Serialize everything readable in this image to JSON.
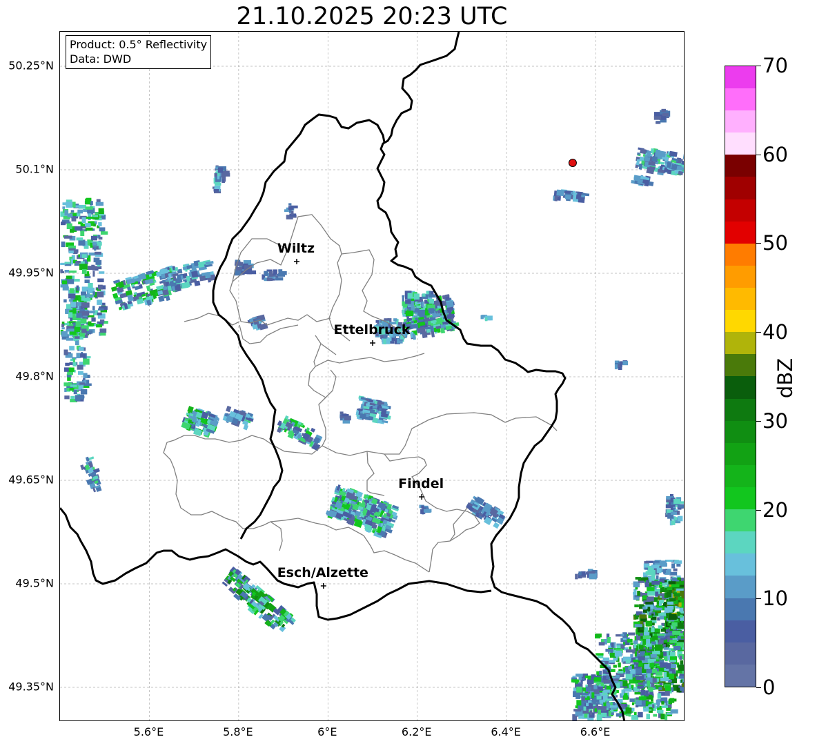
{
  "title": "21.10.2025 20:23 UTC",
  "info": {
    "product": "Product: 0.5° Reflectivity",
    "source": "Data: DWD"
  },
  "map": {
    "lon_range": [
      5.4,
      6.8
    ],
    "lat_range": [
      49.3,
      50.3
    ],
    "lat_ticks": [
      "50.25°N",
      "50.1°N",
      "49.95°N",
      "49.8°N",
      "49.65°N",
      "49.5°N",
      "49.35°N"
    ],
    "lon_ticks": [
      "5.6°E",
      "5.8°E",
      "6°E",
      "6.2°E",
      "6.4°E",
      "6.6°E"
    ],
    "grid": true,
    "cities": [
      {
        "name": "Wiltz",
        "lon": 5.93,
        "lat": 49.967
      },
      {
        "name": "Ettelbruck",
        "lon": 6.1,
        "lat": 49.849
      },
      {
        "name": "Findel",
        "lon": 6.21,
        "lat": 49.626
      },
      {
        "name": "Esch/Alzette",
        "lon": 5.99,
        "lat": 49.497
      }
    ],
    "radar_site": {
      "lon": 6.548,
      "lat": 50.11,
      "color": "#e01010"
    }
  },
  "colorbar": {
    "label": "dBZ",
    "ticks": [
      "0",
      "10",
      "20",
      "30",
      "40",
      "50",
      "60",
      "70"
    ],
    "min": 0,
    "max": 70,
    "step": 2.5,
    "colors": [
      "#6474a6",
      "#5968a0",
      "#4a5ea2",
      "#4a78b0",
      "#5a9cc8",
      "#68c0dc",
      "#5cd6c0",
      "#3ed670",
      "#12c61e",
      "#14b41a",
      "#12a214",
      "#108e12",
      "#0e7a10",
      "#0a5e0c",
      "#4a7a0a",
      "#b0b40a",
      "#ffd800",
      "#ffba00",
      "#ff9c00",
      "#ff7c00",
      "#e20000",
      "#c40000",
      "#a00000",
      "#7a0000",
      "#ffdefe",
      "#ffb0fe",
      "#ff6efa",
      "#ec3cee"
    ]
  }
}
